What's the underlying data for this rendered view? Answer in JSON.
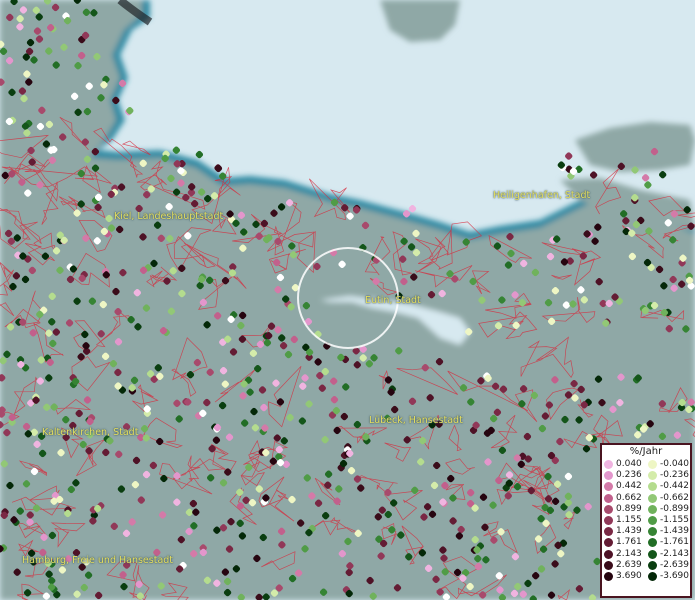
{
  "map": {
    "cities": [
      {
        "name": "Kiel, Landeshauptstadt"
      },
      {
        "name": "Heiligenhafen, Stadt"
      },
      {
        "name": "Eutin, Stadt"
      },
      {
        "name": "Kaltenkirchen, Stadt"
      },
      {
        "name": "Lübeck, Hansestadt"
      },
      {
        "name": "Hamburg, Freie und Hansestadt"
      }
    ]
  },
  "legend": {
    "title": "%/Jahr",
    "positive": [
      {
        "label": "0.040",
        "color": "#f0b4e0"
      },
      {
        "label": "0.236",
        "color": "#e396cc"
      },
      {
        "label": "0.442",
        "color": "#d47aa8"
      },
      {
        "label": "0.662",
        "color": "#c2608c"
      },
      {
        "label": "0.899",
        "color": "#a84a6c"
      },
      {
        "label": "1.155",
        "color": "#913858"
      },
      {
        "label": "1.439",
        "color": "#7a2844"
      },
      {
        "label": "1.761",
        "color": "#641c34"
      },
      {
        "label": "2.143",
        "color": "#4e1226"
      },
      {
        "label": "2.639",
        "color": "#3a0c1a"
      },
      {
        "label": "3.690",
        "color": "#260510"
      }
    ],
    "negative": [
      {
        "label": "-0.040",
        "color": "#eef6c4"
      },
      {
        "label": "-0.236",
        "color": "#d4ecaa"
      },
      {
        "label": "-0.442",
        "color": "#b4dc8e"
      },
      {
        "label": "-0.662",
        "color": "#92c876"
      },
      {
        "label": "-0.899",
        "color": "#70b25c"
      },
      {
        "label": "-1.155",
        "color": "#509c46"
      },
      {
        "label": "-1.439",
        "color": "#368434"
      },
      {
        "label": "-1.761",
        "color": "#226e26"
      },
      {
        "label": "-2.143",
        "color": "#14561a"
      },
      {
        "label": "-2.639",
        "color": "#0a3e10"
      },
      {
        "label": "-3.690",
        "color": "#042808"
      }
    ]
  }
}
